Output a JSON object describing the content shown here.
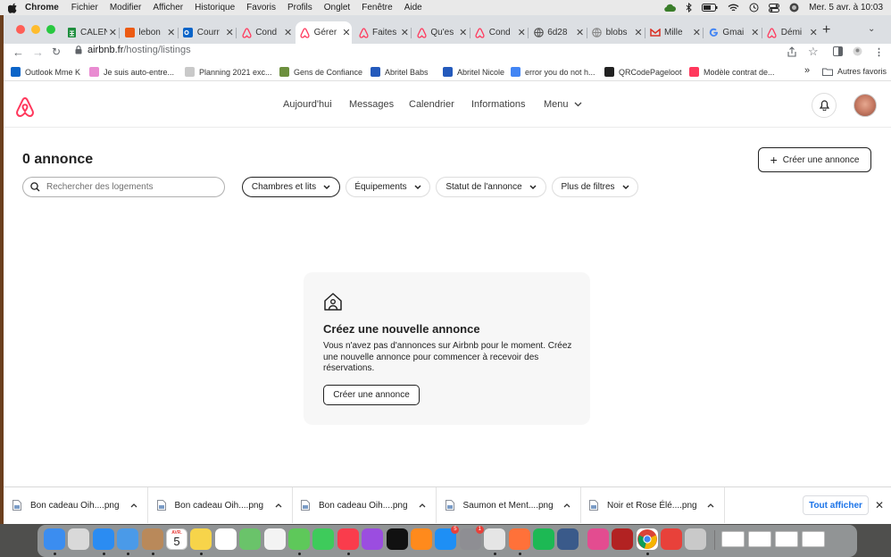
{
  "menubar": {
    "app": "Chrome",
    "items": [
      "Fichier",
      "Modifier",
      "Afficher",
      "Historique",
      "Favoris",
      "Profils",
      "Onglet",
      "Fenêtre",
      "Aide"
    ],
    "datetime": "Mer. 5 avr. à 10:03"
  },
  "tabs": [
    {
      "label": "CALEN",
      "icon": "sheets-icon",
      "color": "#1e8e3e"
    },
    {
      "label": "lebon",
      "icon": "leboncoin-icon",
      "color": "#ec5a13"
    },
    {
      "label": "Courr",
      "icon": "outlook-icon",
      "color": "#0a64c8"
    },
    {
      "label": "Cond",
      "icon": "airbnb-icon",
      "color": "#ff385c"
    },
    {
      "label": "Gérer",
      "icon": "airbnb-icon",
      "color": "#ff385c"
    },
    {
      "label": "Faites",
      "icon": "airbnb-icon",
      "color": "#ff385c"
    },
    {
      "label": "Qu'es",
      "icon": "airbnb-icon",
      "color": "#ff385c"
    },
    {
      "label": "Cond",
      "icon": "airbnb-icon",
      "color": "#ff385c"
    },
    {
      "label": "6d28",
      "icon": "globe-icon",
      "color": "#555555"
    },
    {
      "label": "blobs",
      "icon": "globe-icon",
      "color": "#888888"
    },
    {
      "label": "Mille",
      "icon": "gmail-icon",
      "color": "#d93025"
    },
    {
      "label": "Gmai",
      "icon": "google-icon",
      "color": "#4285f4"
    },
    {
      "label": "Démi",
      "icon": "airbnb-icon",
      "color": "#ff385c"
    }
  ],
  "address": {
    "host": "airbnb.fr",
    "path": "/hosting/listings"
  },
  "bookmarks": [
    {
      "label": "Outlook Mme K",
      "color": "#0a64c8"
    },
    {
      "label": "Je suis auto-entre...",
      "color": "#e98bd1"
    },
    {
      "label": "Planning 2021 exc...",
      "color": "#c9c9c9"
    },
    {
      "label": "Gens de Confiance",
      "color": "#6c8f3d"
    },
    {
      "label": "Abritel Babs",
      "color": "#245abc"
    },
    {
      "label": "Abritel Nicole",
      "color": "#245abc"
    },
    {
      "label": "error you do not h...",
      "color": "#4285f4"
    },
    {
      "label": "QRCodePageloot",
      "color": "#222222"
    },
    {
      "label": "Modèle contrat de...",
      "color": "#ff385c"
    }
  ],
  "bookmarks_more": "»",
  "bookmarks_other": "Autres favoris",
  "airbnb": {
    "brand_color": "#ff385c",
    "nav": [
      "Aujourd'hui",
      "Messages",
      "Calendrier",
      "Informations",
      "Menu"
    ]
  },
  "listings": {
    "title": "0 annonce",
    "create_label": "Créer une annonce",
    "search_placeholder": "Rechercher des logements",
    "filters": [
      "Chambres et lits",
      "Équipements",
      "Statut de l'annonce",
      "Plus de filtres"
    ]
  },
  "empty": {
    "title": "Créez une nouvelle annonce",
    "text": "Vous n'avez pas d'annonces sur Airbnb pour le moment. Créez une nouvelle annonce pour commencer à recevoir des réservations.",
    "button": "Créer une annonce"
  },
  "downloads": {
    "items": [
      "Bon cadeau Oih....png",
      "Bon cadeau Oih....png",
      "Bon cadeau Oih....png",
      "Saumon et Ment....png",
      "Noir et Rose Élé....png"
    ],
    "show_all": "Tout afficher"
  },
  "dock": {
    "calendar_month": "AVR.",
    "calendar_day": "5",
    "apps": [
      "finder-icon",
      "launchpad-icon",
      "safari-icon",
      "mail-icon",
      "contacts-icon",
      "calendar-icon",
      "notes-icon",
      "reminders-icon",
      "maps-icon",
      "photos-icon",
      "messages-icon",
      "facetime-icon",
      "music-icon",
      "podcasts-icon",
      "appletv-icon",
      "books-icon",
      "appstore-icon",
      "settings-icon",
      "preview-icon",
      "firefox-icon",
      "spotify-icon",
      "scanner-icon",
      "pinwheel-icon",
      "filezilla-icon",
      "chrome-icon",
      "anydesk-icon",
      "trash-icon"
    ],
    "appstore_badge": "5",
    "settings_badge": "1"
  }
}
